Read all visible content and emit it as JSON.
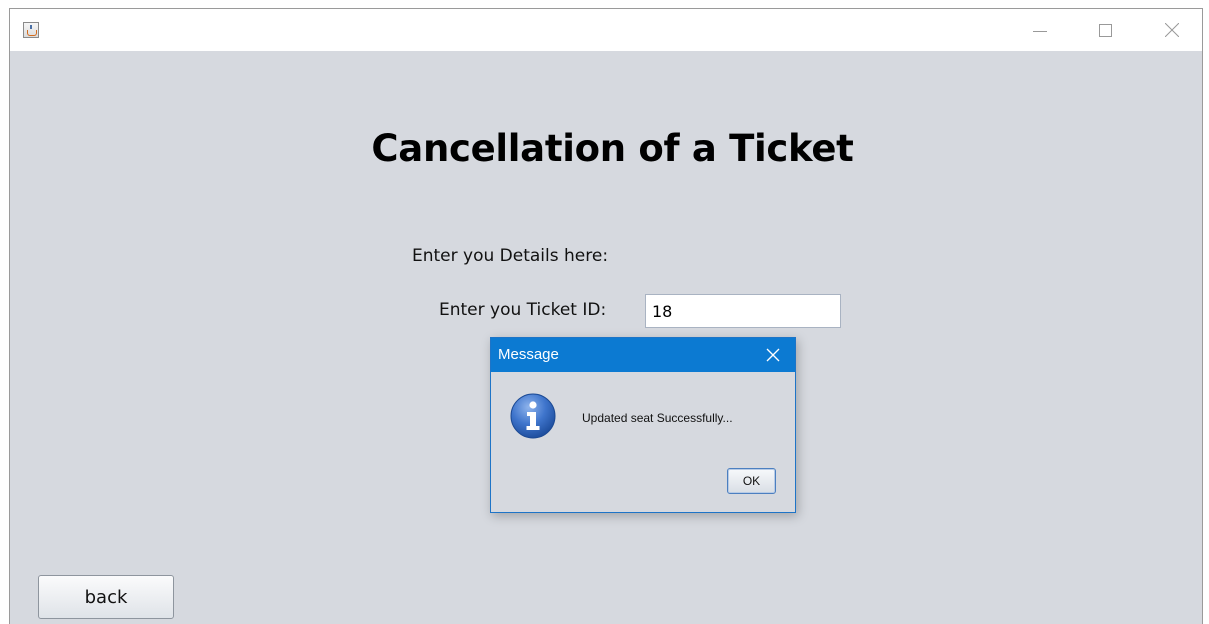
{
  "window": {
    "controls": [
      "minimize",
      "maximize",
      "close"
    ],
    "app_icon": "java-cup-icon"
  },
  "form": {
    "heading": "Cancellation of a Ticket",
    "subheading": "Enter you Details here:",
    "ticket_id_label": "Enter you Ticket ID:",
    "ticket_id_value": "18",
    "back_label": "back"
  },
  "dialog": {
    "title": "Message",
    "message": "Updated seat Successfully...",
    "ok_label": "OK",
    "icon": "info-icon"
  },
  "colors": {
    "window_bg": "#d6d9df",
    "dialog_titlebar": "#0c7ad2",
    "info_icon_blue": "#2f67c2"
  }
}
